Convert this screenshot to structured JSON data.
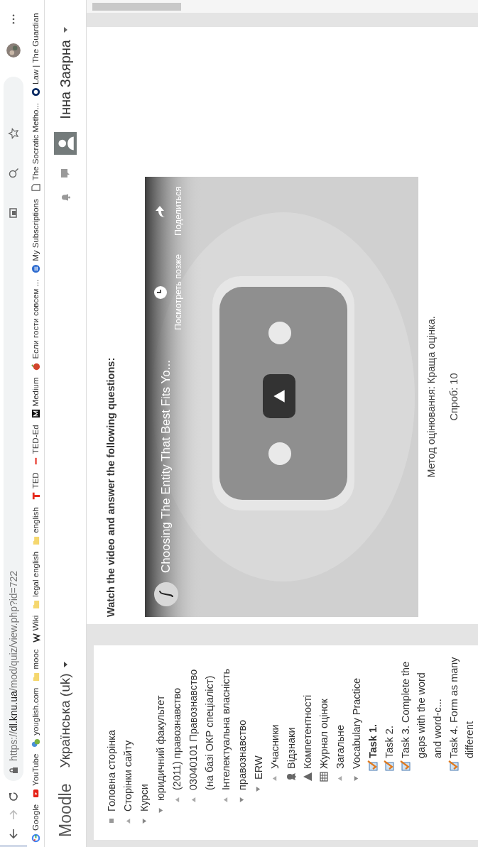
{
  "browser": {
    "url": "https://**dl.knu.ua**/mod/quiz/view.php?id=722"
  },
  "bookmarks": [
    {
      "label": "Google",
      "kind": "google"
    },
    {
      "label": "YouTube",
      "kind": "youtube"
    },
    {
      "label": "youglish.com",
      "kind": "youglish"
    },
    {
      "label": "mooc",
      "kind": "folder"
    },
    {
      "label": "Wiki",
      "kind": "wiki"
    },
    {
      "label": "legal english",
      "kind": "folder"
    },
    {
      "label": "english",
      "kind": "folder"
    },
    {
      "label": "TED",
      "kind": "ted"
    },
    {
      "label": "TED-Ed",
      "kind": "teded"
    },
    {
      "label": "Medium",
      "kind": "medium"
    },
    {
      "label": "Если гости совсем ...",
      "kind": "fruit"
    },
    {
      "label": "My Subscriptions",
      "kind": "subscriptions"
    },
    {
      "label": "The Socratic Metho...",
      "kind": "page"
    },
    {
      "label": "Law | The Guardian",
      "kind": "guardian"
    }
  ],
  "navbar": {
    "brand": "Moodle",
    "language": "Українська (uk)",
    "user": "Інна Заярна"
  },
  "sidebar": {
    "items": [
      {
        "label": "Головна сторінка",
        "kind": "home"
      },
      {
        "label": "Сторінки сайту",
        "kind": "branch",
        "expanded": false
      },
      {
        "label": "Курси",
        "kind": "branch",
        "expanded": true,
        "children": [
          {
            "label": "юридичний факультет",
            "kind": "branch",
            "expanded": true,
            "children": [
              {
                "label": "(2011) правознавство",
                "kind": "branch",
                "expanded": false
              },
              {
                "label": "03040101 Правознавство (на базі ОКР спеціаліст)",
                "kind": "branch",
                "expanded": false
              },
              {
                "label": "Інтелектуальна власність",
                "kind": "branch",
                "expanded": false
              },
              {
                "label": "правознавство",
                "kind": "branch",
                "expanded": true,
                "children": [
                  {
                    "label": "ERW",
                    "kind": "branch",
                    "expanded": true,
                    "children": [
                      {
                        "label": "Учасники",
                        "kind": "branch",
                        "expanded": false
                      },
                      {
                        "label": "Відзнаки",
                        "kind": "badges"
                      },
                      {
                        "label": "Компетентності",
                        "kind": "competencies"
                      },
                      {
                        "label": "Журнал оцінок",
                        "kind": "grades"
                      },
                      {
                        "label": "Загальне",
                        "kind": "branch",
                        "expanded": false
                      },
                      {
                        "label": "Vocabulary Practice",
                        "kind": "branch",
                        "expanded": true,
                        "children": [
                          {
                            "label": "Task 1.",
                            "kind": "quiz",
                            "selected": true
                          },
                          {
                            "label": "Task 2.",
                            "kind": "quiz",
                            "selected": false
                          },
                          {
                            "label": "Task 3. Complete the gaps with the word and word-c...",
                            "kind": "quiz",
                            "selected": false
                          },
                          {
                            "label": "Task 4. Form as many different",
                            "kind": "quiz",
                            "selected": false
                          }
                        ]
                      }
                    ]
                  }
                ]
              }
            ]
          }
        ]
      }
    ]
  },
  "content": {
    "instruction": "Watch the video and answer the following questions:",
    "video": {
      "title": "Choosing The Entity That Best Fits Yo...",
      "watch_later": "Посмотреть позже",
      "share": "Поделиться"
    },
    "grading_method": "Метод оцінювання: Краща оцінка.",
    "attempts": "Спроб: 10"
  }
}
